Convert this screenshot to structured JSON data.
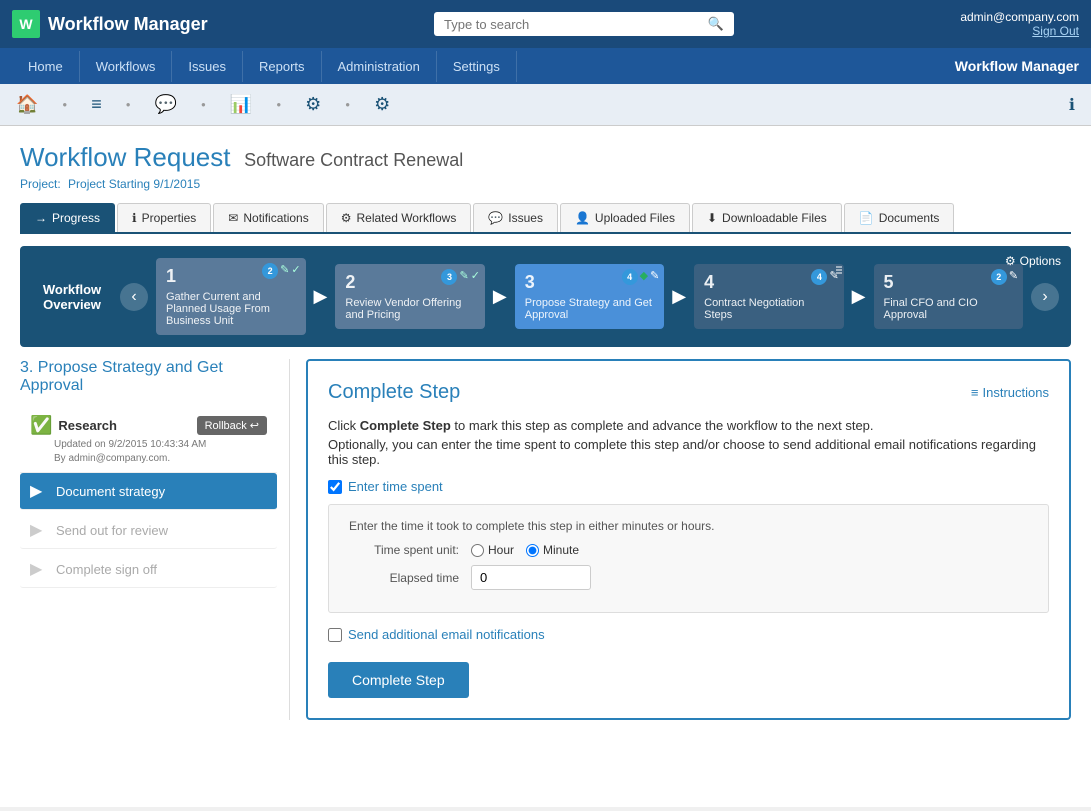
{
  "app": {
    "title": "Workflow Manager",
    "logo_letter": "W",
    "search_placeholder": "Type to search",
    "user_email": "admin@company.com",
    "sign_out": "Sign Out",
    "nav_label": "Workflow Manager"
  },
  "nav": {
    "items": [
      "Home",
      "Workflows",
      "Issues",
      "Reports",
      "Administration",
      "Settings"
    ]
  },
  "page": {
    "title": "Workflow Request",
    "subtitle": "Software Contract Renewal",
    "project_label": "Project:",
    "project_name": "Project Starting 9/1/2015"
  },
  "tabs": [
    {
      "label": "Progress",
      "icon": "→",
      "active": true
    },
    {
      "label": "Properties",
      "icon": "ℹ"
    },
    {
      "label": "Notifications",
      "icon": "✉"
    },
    {
      "label": "Related Workflows",
      "icon": "⚙"
    },
    {
      "label": "Issues",
      "icon": "💬"
    },
    {
      "label": "Uploaded Files",
      "icon": "👤"
    },
    {
      "label": "Downloadable Files",
      "icon": "⬇"
    },
    {
      "label": "Documents",
      "icon": "📄"
    }
  ],
  "workflow_overview": {
    "label": "Workflow Overview",
    "options_label": "Options",
    "steps": [
      {
        "num": "1",
        "title": "Gather Current and Planned Usage From Business Unit",
        "badge_count": "2",
        "icons": [
          "✎",
          "✓"
        ],
        "active": false
      },
      {
        "num": "2",
        "title": "Review Vendor Offering and Pricing",
        "badge_count": "3",
        "icons": [
          "✎",
          "✓"
        ],
        "active": false
      },
      {
        "num": "3",
        "title": "Propose Strategy and Get Approval",
        "badge_count": "4",
        "icons": [
          "◆",
          "✎"
        ],
        "active": true
      },
      {
        "num": "4",
        "title": "Contract Negotiation Steps",
        "badge_count": "4",
        "icons": [
          "✎"
        ],
        "active": false
      },
      {
        "num": "5",
        "title": "Final CFO and CIO Approval",
        "badge_count": "2",
        "icons": [
          "✎"
        ],
        "active": false
      }
    ]
  },
  "left_panel": {
    "title": "3. Propose Strategy and Get Approval",
    "research": {
      "label": "Research",
      "rollback_label": "Rollback",
      "updated": "Updated on 9/2/2015 10:43:34 AM",
      "by": "By admin@company.com."
    },
    "steps": [
      {
        "label": "Document strategy",
        "active": true,
        "icon": "▶",
        "disabled": false
      },
      {
        "label": "Send out for review",
        "active": false,
        "icon": "▶",
        "disabled": true
      },
      {
        "label": "Complete sign off",
        "active": false,
        "icon": "▶",
        "disabled": true
      }
    ]
  },
  "complete_step": {
    "title": "Complete Step",
    "instructions_label": "Instructions",
    "desc1_pre": "Click ",
    "desc1_bold": "Complete Step",
    "desc1_post": " to mark this step as complete and advance the workflow to the next step.",
    "desc2": "Optionally, you can enter the time spent to complete this step and/or choose to send additional email notifications regarding this step.",
    "enter_time_label": "Enter time spent",
    "time_box_desc": "Enter the time it took to complete this step in either minutes or hours.",
    "time_unit_label": "Time spent unit:",
    "time_unit_options": [
      "Hour",
      "Minute"
    ],
    "time_unit_selected": "Minute",
    "elapsed_label": "Elapsed time",
    "elapsed_value": "0",
    "email_label": "Send additional email notifications",
    "button_label": "Complete Step"
  }
}
